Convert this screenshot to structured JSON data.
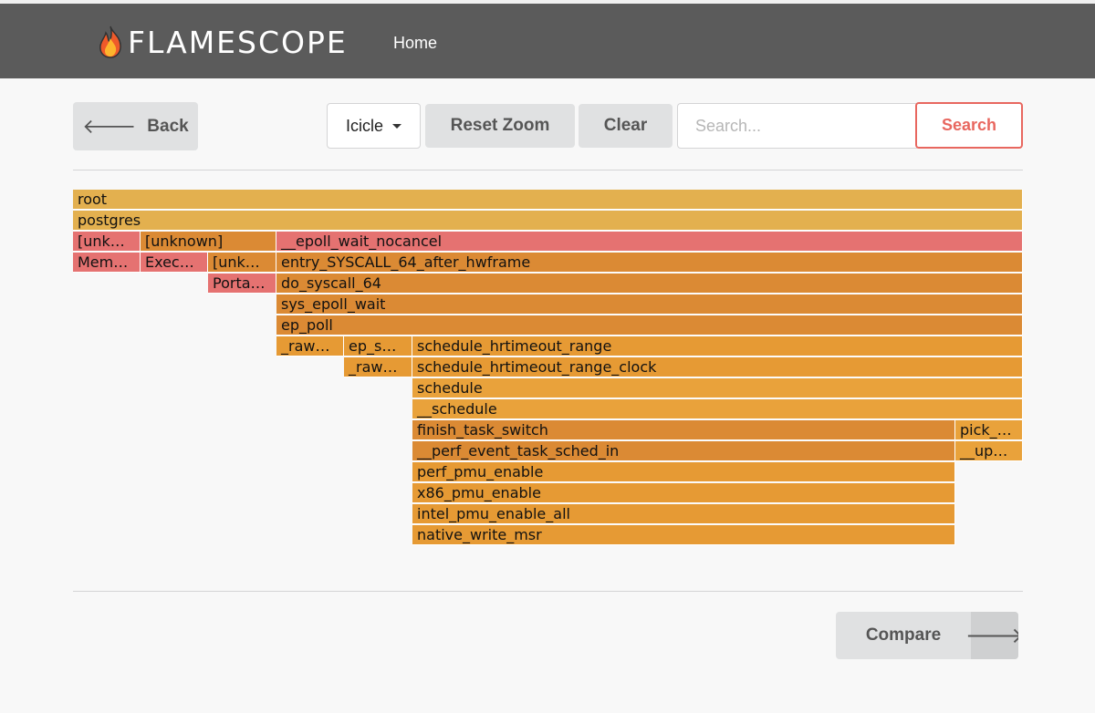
{
  "header": {
    "logo_icon": "flame-icon",
    "app_title": "FLAMESCOPE",
    "nav_home": "Home",
    "background_color": "#5b5b5b"
  },
  "toolbar": {
    "back_label": "Back",
    "back_icon": "arrow-left-icon",
    "layout_dropdown": {
      "selected": "Icicle",
      "icon": "caret-down-icon"
    },
    "reset_zoom_label": "Reset Zoom",
    "clear_label": "Clear",
    "search_placeholder": "Search...",
    "search_value": "",
    "search_label": "Search",
    "search_color": "#e8675f"
  },
  "graph": {
    "colors": {
      "yellow": "#e3b04f",
      "red": "#e57271",
      "orange_dark": "#db8a34",
      "orange": "#e69a34",
      "orange_light": "#e9a23b"
    },
    "frames": [
      {
        "label": "root",
        "color": "#e3b04f"
      },
      {
        "label": "postgres",
        "color": "#e3b04f"
      },
      {
        "label": "[unk…",
        "color": "#e57271"
      },
      {
        "label": "[unknown]",
        "color": "#db8a34"
      },
      {
        "label": "__epoll_wait_nocancel",
        "color": "#e57271"
      },
      {
        "label": "Mem…",
        "color": "#e57271"
      },
      {
        "label": "Exec…",
        "color": "#e57271"
      },
      {
        "label": "[unk…",
        "color": "#db8a34"
      },
      {
        "label": "entry_SYSCALL_64_after_hwframe",
        "color": "#db8a34"
      },
      {
        "label": "Porta…",
        "color": "#e57271"
      },
      {
        "label": "do_syscall_64",
        "color": "#db8a34"
      },
      {
        "label": "sys_epoll_wait",
        "color": "#db8a34"
      },
      {
        "label": "ep_poll",
        "color": "#db8a34"
      },
      {
        "label": "_raw…",
        "color": "#e69a34"
      },
      {
        "label": "ep_s…",
        "color": "#e69a34"
      },
      {
        "label": "schedule_hrtimeout_range",
        "color": "#e69a34"
      },
      {
        "label": "_raw…",
        "color": "#e69a34"
      },
      {
        "label": "schedule_hrtimeout_range_clock",
        "color": "#e69a34"
      },
      {
        "label": "schedule",
        "color": "#e9a23b"
      },
      {
        "label": "__schedule",
        "color": "#e9a23b"
      },
      {
        "label": "finish_task_switch",
        "color": "#db8a34"
      },
      {
        "label": "pick_…",
        "color": "#e9a23b"
      },
      {
        "label": "__perf_event_task_sched_in",
        "color": "#db8a34"
      },
      {
        "label": "__up…",
        "color": "#e9a23b"
      },
      {
        "label": "perf_pmu_enable",
        "color": "#e69a34"
      },
      {
        "label": "x86_pmu_enable",
        "color": "#e69a34"
      },
      {
        "label": "intel_pmu_enable_all",
        "color": "#e69a34"
      },
      {
        "label": "native_write_msr",
        "color": "#e69a34"
      }
    ]
  },
  "footer": {
    "compare_label": "Compare",
    "compare_icon": "arrow-right-icon"
  }
}
